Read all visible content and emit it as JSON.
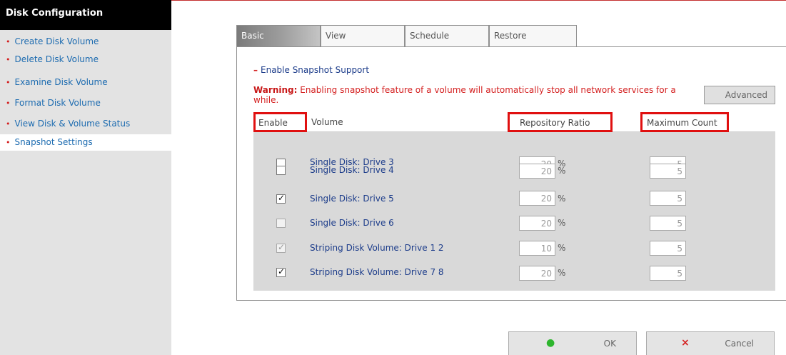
{
  "sidebar": {
    "title": "Disk Configuration",
    "items": [
      {
        "label": "Create Disk Volume"
      },
      {
        "label": "Delete Disk Volume"
      },
      {
        "label": "Examine Disk Volume"
      },
      {
        "label": "Format Disk Volume"
      },
      {
        "label": "View Disk & Volume Status"
      },
      {
        "label": "Snapshot Settings",
        "active": true
      }
    ],
    "bullet": "•"
  },
  "tabs": [
    {
      "label": "Basic",
      "active": true
    },
    {
      "label": "View"
    },
    {
      "label": "Schedule"
    },
    {
      "label": "Restore"
    }
  ],
  "snapshot": {
    "toggle_symbol": "–",
    "title": "Enable Snapshot Support",
    "warning_label": "Warning:",
    "warning_text": " Enabling snapshot feature of a volume will automatically stop all network services for a while.",
    "advanced_label": "Advanced"
  },
  "table": {
    "headers": {
      "enable": "Enable",
      "volume": "Volume",
      "ratio": "Repository Ratio",
      "count": "Maximum Count"
    },
    "unit": "%",
    "rows": [
      {
        "enabled": false,
        "disabled": false,
        "volume": "Single Disk: Drive 3",
        "ratio": "20",
        "count": "5"
      },
      {
        "enabled": false,
        "disabled": false,
        "volume": "Single Disk: Drive 4",
        "ratio": "20",
        "count": "5"
      },
      {
        "enabled": true,
        "disabled": false,
        "volume": "Single Disk: Drive 5",
        "ratio": "20",
        "count": "5"
      },
      {
        "enabled": false,
        "disabled": true,
        "volume": "Single Disk: Drive 6",
        "ratio": "20",
        "count": "5"
      },
      {
        "enabled": true,
        "disabled": true,
        "volume": "Striping Disk Volume: Drive 1 2",
        "ratio": "10",
        "count": "5"
      },
      {
        "enabled": true,
        "disabled": false,
        "volume": "Striping Disk Volume: Drive 7 8",
        "ratio": "20",
        "count": "5"
      }
    ]
  },
  "buttons": {
    "ok": {
      "icon": "●",
      "label": "OK",
      "color": "#2db52d"
    },
    "cancel": {
      "icon": "×",
      "label": "Cancel",
      "color": "#d42020"
    }
  },
  "colors": {
    "accent_red": "#d42020",
    "link_blue": "#1c3c8a",
    "sidebar_link": "#1c6bb0"
  }
}
